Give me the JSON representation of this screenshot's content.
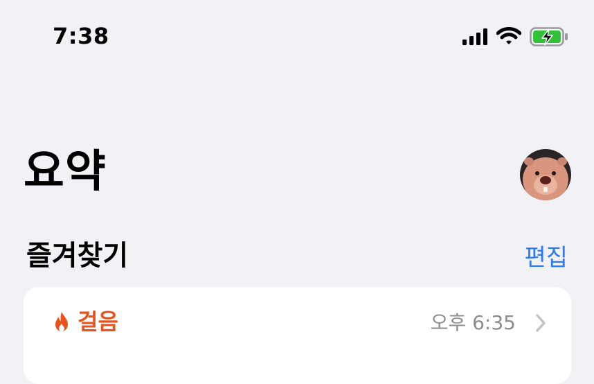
{
  "status_bar": {
    "time": "7:38"
  },
  "header": {
    "title": "요약"
  },
  "favorites": {
    "section_title": "즐겨찾기",
    "edit_label": "편집"
  },
  "cards": [
    {
      "title": "걸음",
      "time": "오후 6:35",
      "icon": "flame-icon"
    }
  ],
  "colors": {
    "accent": "#2a7bf6",
    "activity": "#e8531c",
    "background": "#f2f1f6"
  }
}
